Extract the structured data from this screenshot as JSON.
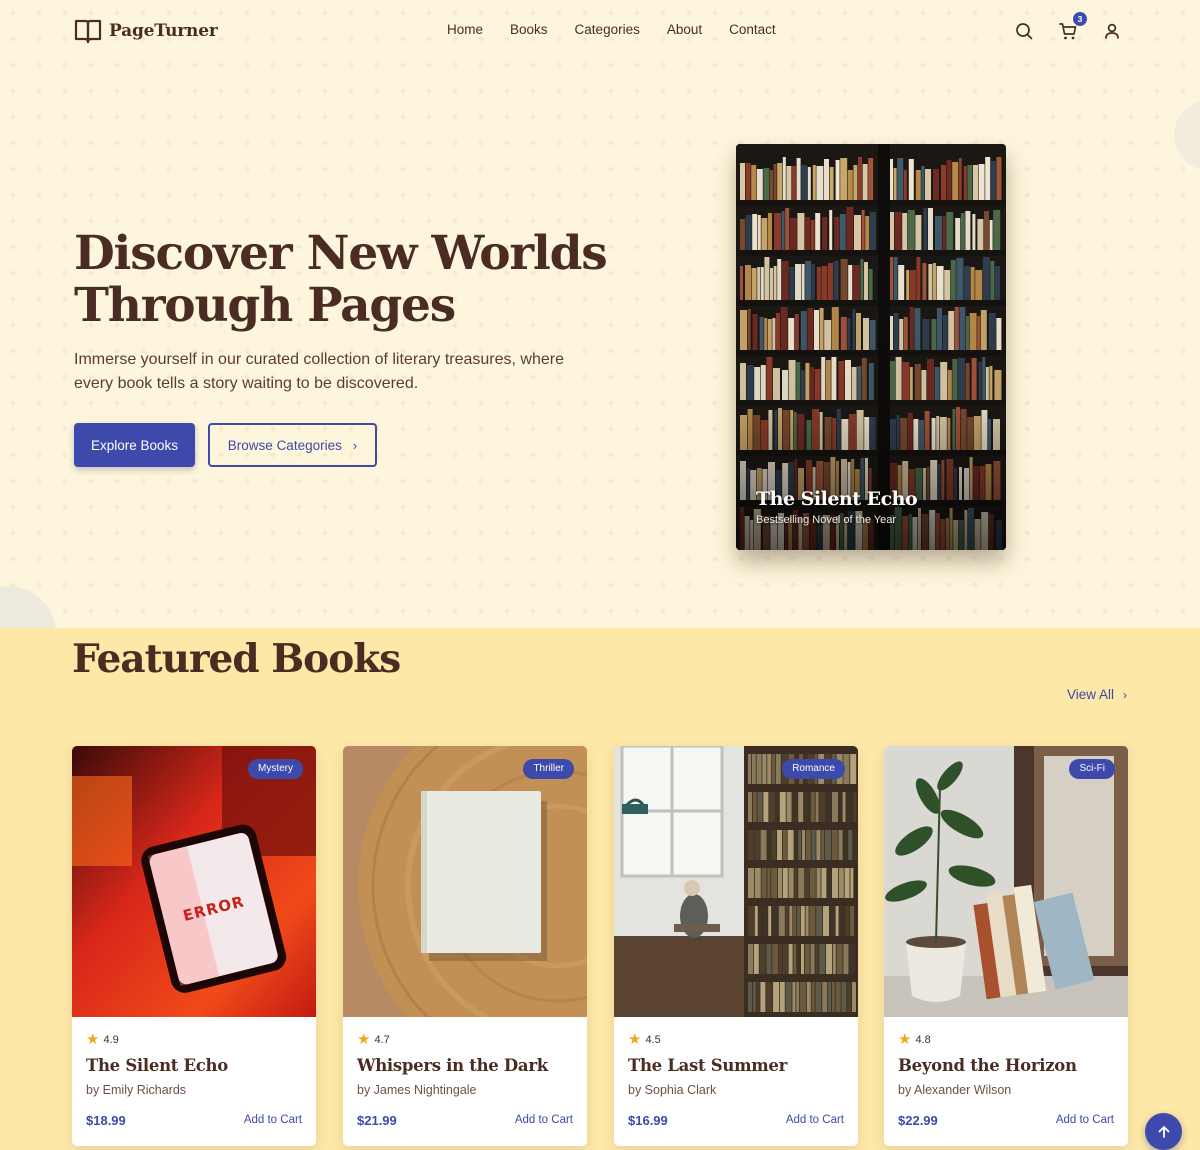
{
  "brand": {
    "name": "PageTurner",
    "logo_icon": "open-book-icon"
  },
  "nav": {
    "items": [
      "Home",
      "Books",
      "Categories",
      "About",
      "Contact"
    ]
  },
  "header": {
    "search_icon": "search-icon",
    "cart_icon": "cart-icon",
    "cart_count": "3",
    "user_icon": "user-icon"
  },
  "hero": {
    "title": "Discover New Worlds Through Pages",
    "subtitle": "Immerse yourself in our curated collection of literary treasures, where every book tells a story waiting to be discovered.",
    "primary_button": "Explore Books",
    "secondary_button": "Browse Categories",
    "feature": {
      "title": "The Silent Echo",
      "subtitle": "Bestselling Novel of the Year"
    }
  },
  "featured": {
    "title": "Featured Books",
    "view_all": "View All",
    "books": [
      {
        "genre": "Mystery",
        "rating": "4.9",
        "title": "The Silent Echo",
        "author": "by Emily Richards",
        "price": "$18.99",
        "action": "Add to Cart",
        "image_text": "ERROR"
      },
      {
        "genre": "Thriller",
        "rating": "4.7",
        "title": "Whispers in the Dark",
        "author": "by James Nightingale",
        "price": "$21.99",
        "action": "Add to Cart"
      },
      {
        "genre": "Romance",
        "rating": "4.5",
        "title": "The Last Summer",
        "author": "by Sophia Clark",
        "price": "$16.99",
        "action": "Add to Cart"
      },
      {
        "genre": "Sci-Fi",
        "rating": "4.8",
        "title": "Beyond the Horizon",
        "author": "by Alexander Wilson",
        "price": "$22.99",
        "action": "Add to Cart"
      }
    ]
  },
  "colors": {
    "accent": "#3d49ab",
    "text": "#4a2c22",
    "hero_bg": "#fef6dc",
    "section_bg": "#fde8a8",
    "star": "#f2a71c"
  },
  "scroll_top_icon": "arrow-up-icon"
}
